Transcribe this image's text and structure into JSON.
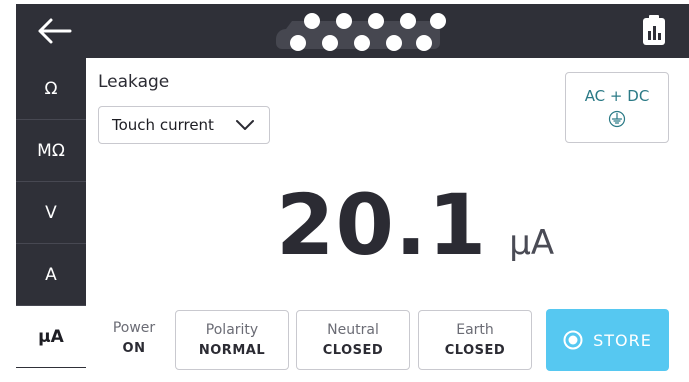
{
  "header": {
    "back_icon": "arrow-left-icon",
    "connection_icon": "terminal-dots-icon",
    "report_icon": "clipboard-chart-icon"
  },
  "sidebar": {
    "items": [
      {
        "label": "Ω",
        "active": false
      },
      {
        "label": "MΩ",
        "active": false
      },
      {
        "label": "V",
        "active": false
      },
      {
        "label": "A",
        "active": false
      },
      {
        "label": "µA",
        "active": true
      }
    ]
  },
  "main": {
    "title": "Leakage",
    "test_select": {
      "value": "Touch current"
    },
    "mode": {
      "label": "AC + DC",
      "icon": "earth-ground-icon"
    },
    "reading": {
      "value": "20.1",
      "unit": "µA"
    },
    "status": {
      "power": {
        "label": "Power",
        "value": "ON"
      },
      "polarity": {
        "label": "Polarity",
        "value": "NORMAL"
      },
      "neutral": {
        "label": "Neutral",
        "value": "CLOSED"
      },
      "earth": {
        "label": "Earth",
        "value": "CLOSED"
      }
    },
    "store_label": "STORE"
  },
  "colors": {
    "header_bg": "#2f3038",
    "accent": "#56c8f1",
    "mode_text": "#2b7a86"
  }
}
